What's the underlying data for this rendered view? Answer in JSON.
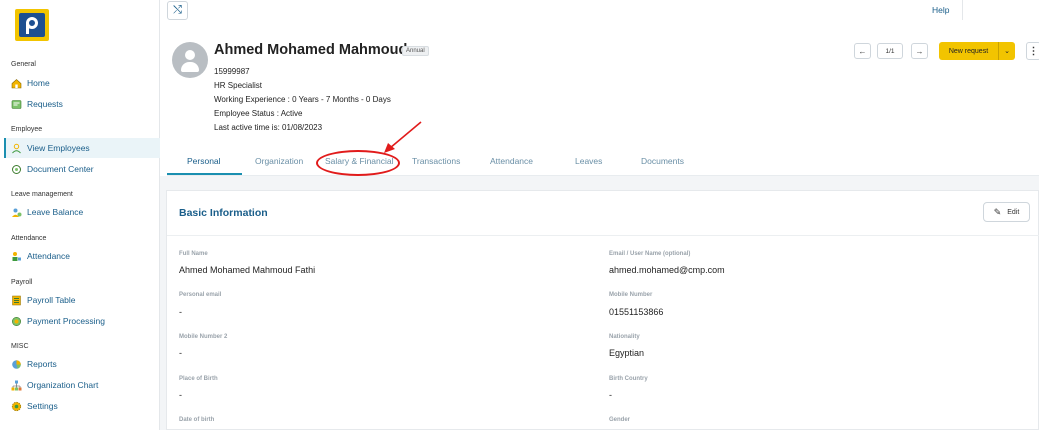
{
  "sidebar": {
    "sections": [
      {
        "label": "General",
        "items": [
          {
            "label": "Home",
            "icon": "home-icon"
          },
          {
            "label": "Requests",
            "icon": "requests-icon"
          }
        ]
      },
      {
        "label": "Employee",
        "items": [
          {
            "label": "View Employees",
            "icon": "user-icon"
          },
          {
            "label": "Document Center",
            "icon": "document-icon"
          }
        ]
      },
      {
        "label": "Leave management",
        "items": [
          {
            "label": "Leave Balance",
            "icon": "leave-balance-icon"
          }
        ]
      },
      {
        "label": "Attendance",
        "items": [
          {
            "label": "Attendance",
            "icon": "attendance-icon"
          }
        ]
      },
      {
        "label": "Payroll",
        "items": [
          {
            "label": "Payroll Table",
            "icon": "payroll-table-icon"
          },
          {
            "label": "Payment Processing",
            "icon": "payment-icon"
          }
        ]
      },
      {
        "label": "MISC",
        "items": [
          {
            "label": "Reports",
            "icon": "reports-icon"
          },
          {
            "label": "Organization Chart",
            "icon": "org-chart-icon"
          },
          {
            "label": "Settings",
            "icon": "gear-icon"
          }
        ]
      }
    ]
  },
  "topbar": {
    "help_label": "Help"
  },
  "employee": {
    "name": "Ahmed Mohamed Mahmoud",
    "badge": "Annual",
    "id": "15999987",
    "title": "HR Specialist",
    "experience": "Working Experience : 0 Years - 7 Months - 0 Days",
    "status": "Employee Status : Active",
    "last_active": "Last active time is: 01/08/2023"
  },
  "actions": {
    "prev": "←",
    "page": "1/1",
    "next": "→",
    "new_request": "New request",
    "caret": "⌄",
    "more": "⋮"
  },
  "tabs": [
    "Personal",
    "Organization",
    "Salary & Financial",
    "Transactions",
    "Attendance",
    "Leaves",
    "Documents"
  ],
  "active_tab": "Personal",
  "card": {
    "title": "Basic Information",
    "edit_label": "Edit",
    "fields": [
      {
        "label": "Full Name",
        "value": "Ahmed Mohamed Mahmoud Fathi"
      },
      {
        "label": "Email / User Name (optional)",
        "value": "ahmed.mohamed@cmp.com"
      },
      {
        "label": "Personal email",
        "value": "-"
      },
      {
        "label": "Mobile Number",
        "value": "01551153866"
      },
      {
        "label": "Mobile Number 2",
        "value": "-"
      },
      {
        "label": "Nationality",
        "value": "Egyptian"
      },
      {
        "label": "Place of Birth",
        "value": "-"
      },
      {
        "label": "Birth Country",
        "value": "-"
      },
      {
        "label": "Date of birth",
        "value": ""
      },
      {
        "label": "Gender",
        "value": ""
      }
    ]
  },
  "colors": {
    "accent": "#1a8fb0",
    "link": "#1a5e8a",
    "brand_yellow": "#f2c400",
    "brand_blue": "#1d4f91",
    "annotation_red": "#e11b1b"
  }
}
